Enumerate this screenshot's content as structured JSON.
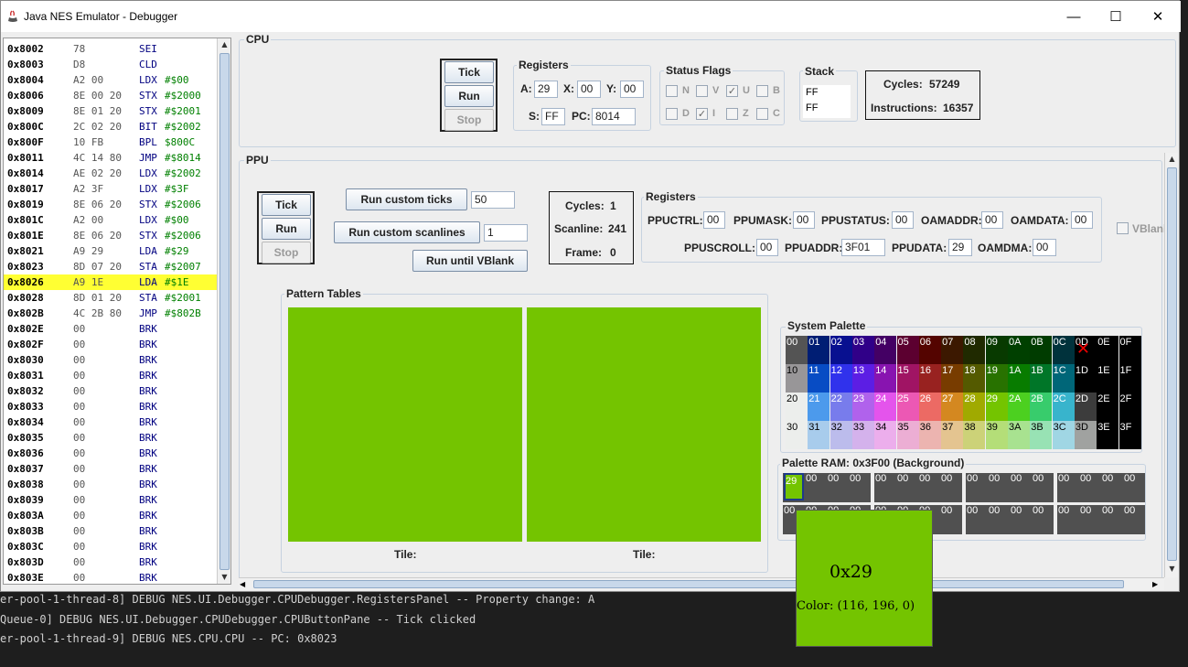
{
  "window": {
    "title": "Java NES Emulator - Debugger",
    "minimize": "—",
    "maximize": "☐",
    "close": "✕"
  },
  "code": {
    "rows": [
      {
        "addr": "0x8002",
        "bytes": "78",
        "mn": "SEI",
        "op": ""
      },
      {
        "addr": "0x8003",
        "bytes": "D8",
        "mn": "CLD",
        "op": ""
      },
      {
        "addr": "0x8004",
        "bytes": "A2 00",
        "mn": "LDX",
        "op": "#$00"
      },
      {
        "addr": "0x8006",
        "bytes": "8E 00 20",
        "mn": "STX",
        "op": "#$2000"
      },
      {
        "addr": "0x8009",
        "bytes": "8E 01 20",
        "mn": "STX",
        "op": "#$2001"
      },
      {
        "addr": "0x800C",
        "bytes": "2C 02 20",
        "mn": "BIT",
        "op": "#$2002"
      },
      {
        "addr": "0x800F",
        "bytes": "10 FB",
        "mn": "BPL",
        "op": "$800C"
      },
      {
        "addr": "0x8011",
        "bytes": "4C 14 80",
        "mn": "JMP",
        "op": "#$8014"
      },
      {
        "addr": "0x8014",
        "bytes": "AE 02 20",
        "mn": "LDX",
        "op": "#$2002"
      },
      {
        "addr": "0x8017",
        "bytes": "A2 3F",
        "mn": "LDX",
        "op": "#$3F"
      },
      {
        "addr": "0x8019",
        "bytes": "8E 06 20",
        "mn": "STX",
        "op": "#$2006"
      },
      {
        "addr": "0x801C",
        "bytes": "A2 00",
        "mn": "LDX",
        "op": "#$00"
      },
      {
        "addr": "0x801E",
        "bytes": "8E 06 20",
        "mn": "STX",
        "op": "#$2006"
      },
      {
        "addr": "0x8021",
        "bytes": "A9 29",
        "mn": "LDA",
        "op": "#$29"
      },
      {
        "addr": "0x8023",
        "bytes": "8D 07 20",
        "mn": "STA",
        "op": "#$2007"
      },
      {
        "addr": "0x8026",
        "bytes": "A9 1E",
        "mn": "LDA",
        "op": "#$1E",
        "hl": true
      },
      {
        "addr": "0x8028",
        "bytes": "8D 01 20",
        "mn": "STA",
        "op": "#$2001"
      },
      {
        "addr": "0x802B",
        "bytes": "4C 2B 80",
        "mn": "JMP",
        "op": "#$802B"
      },
      {
        "addr": "0x802E",
        "bytes": "00",
        "mn": "BRK",
        "op": ""
      },
      {
        "addr": "0x802F",
        "bytes": "00",
        "mn": "BRK",
        "op": ""
      },
      {
        "addr": "0x8030",
        "bytes": "00",
        "mn": "BRK",
        "op": ""
      },
      {
        "addr": "0x8031",
        "bytes": "00",
        "mn": "BRK",
        "op": ""
      },
      {
        "addr": "0x8032",
        "bytes": "00",
        "mn": "BRK",
        "op": ""
      },
      {
        "addr": "0x8033",
        "bytes": "00",
        "mn": "BRK",
        "op": ""
      },
      {
        "addr": "0x8034",
        "bytes": "00",
        "mn": "BRK",
        "op": ""
      },
      {
        "addr": "0x8035",
        "bytes": "00",
        "mn": "BRK",
        "op": ""
      },
      {
        "addr": "0x8036",
        "bytes": "00",
        "mn": "BRK",
        "op": ""
      },
      {
        "addr": "0x8037",
        "bytes": "00",
        "mn": "BRK",
        "op": ""
      },
      {
        "addr": "0x8038",
        "bytes": "00",
        "mn": "BRK",
        "op": ""
      },
      {
        "addr": "0x8039",
        "bytes": "00",
        "mn": "BRK",
        "op": ""
      },
      {
        "addr": "0x803A",
        "bytes": "00",
        "mn": "BRK",
        "op": ""
      },
      {
        "addr": "0x803B",
        "bytes": "00",
        "mn": "BRK",
        "op": ""
      },
      {
        "addr": "0x803C",
        "bytes": "00",
        "mn": "BRK",
        "op": ""
      },
      {
        "addr": "0x803D",
        "bytes": "00",
        "mn": "BRK",
        "op": ""
      },
      {
        "addr": "0x803E",
        "bytes": "00",
        "mn": "BRK",
        "op": ""
      }
    ]
  },
  "cpu": {
    "title": "CPU",
    "tick": "Tick",
    "run": "Run",
    "stop": "Stop",
    "registers_title": "Registers",
    "a_label": "A:",
    "a": "29",
    "x_label": "X:",
    "x": "00",
    "y_label": "Y:",
    "y": "00",
    "s_label": "S:",
    "s": "FF",
    "pc_label": "PC:",
    "pc": "8014",
    "flags_title": "Status Flags",
    "flags": [
      {
        "name": "N",
        "checked": false
      },
      {
        "name": "V",
        "checked": false
      },
      {
        "name": "U",
        "checked": true
      },
      {
        "name": "B",
        "checked": false
      },
      {
        "name": "D",
        "checked": false
      },
      {
        "name": "I",
        "checked": true
      },
      {
        "name": "Z",
        "checked": false
      },
      {
        "name": "C",
        "checked": false
      }
    ],
    "stack_title": "Stack",
    "stack": [
      "FF",
      "FF"
    ],
    "cycles_label": "Cycles:",
    "cycles": "57249",
    "instructions_label": "Instructions:",
    "instructions": "16357"
  },
  "ppu": {
    "title": "PPU",
    "tick": "Tick",
    "run": "Run",
    "stop": "Stop",
    "run_ticks": "Run custom ticks",
    "ticks_value": "50",
    "run_scanlines": "Run custom scanlines",
    "scanlines_value": "1",
    "run_vblank": "Run until VBlank",
    "cycles_label": "Cycles:",
    "cycles": "1",
    "scanline_label": "Scanline:",
    "scanline": "241",
    "frame_label": "Frame:",
    "frame": "0",
    "registers_title": "Registers",
    "regs_row1": [
      {
        "label": "PPUCTRL:",
        "value": "00"
      },
      {
        "label": "PPUMASK:",
        "value": "00"
      },
      {
        "label": "PPUSTATUS:",
        "value": "00"
      },
      {
        "label": "OAMADDR:",
        "value": "00"
      },
      {
        "label": "OAMDATA:",
        "value": "00"
      }
    ],
    "regs_row2": [
      {
        "label": "PPUSCROLL:",
        "value": "00"
      },
      {
        "label": "PPUADDR:",
        "value": "3F01"
      },
      {
        "label": "PPUDATA:",
        "value": "29"
      },
      {
        "label": "OAMDMA:",
        "value": "00"
      }
    ],
    "vblank_label": "VBlank",
    "pattern_title": "Pattern Tables",
    "tile_label": "Tile:",
    "pattern_color": "#74c400",
    "system_palette_title": "System Palette",
    "palette": [
      [
        "00",
        "01",
        "02",
        "03",
        "04",
        "05",
        "06",
        "07",
        "08",
        "09",
        "0A",
        "0B",
        "0C",
        "0D",
        "0E",
        "0F"
      ],
      [
        "10",
        "11",
        "12",
        "13",
        "14",
        "15",
        "16",
        "17",
        "18",
        "19",
        "1A",
        "1B",
        "1C",
        "1D",
        "1E",
        "1F"
      ],
      [
        "20",
        "21",
        "22",
        "23",
        "24",
        "25",
        "26",
        "27",
        "28",
        "29",
        "2A",
        "2B",
        "2C",
        "2D",
        "2E",
        "2F"
      ],
      [
        "30",
        "31",
        "32",
        "33",
        "34",
        "35",
        "36",
        "37",
        "38",
        "39",
        "3A",
        "3B",
        "3C",
        "3D",
        "3E",
        "3F"
      ]
    ],
    "palette_colors": [
      [
        "#545454",
        "#001e74",
        "#081090",
        "#300088",
        "#440064",
        "#5c0030",
        "#540400",
        "#3c1800",
        "#202a00",
        "#083a00",
        "#004000",
        "#003c00",
        "#00323c",
        "#000000",
        "#000000",
        "#000000"
      ],
      [
        "#989698",
        "#084cc4",
        "#3032ec",
        "#5c1ee4",
        "#8814b0",
        "#a01464",
        "#982220",
        "#783c00",
        "#545a00",
        "#287200",
        "#087c00",
        "#007628",
        "#006678",
        "#000000",
        "#000000",
        "#000000"
      ],
      [
        "#eceeec",
        "#4c9aec",
        "#787cec",
        "#b062ec",
        "#e454ec",
        "#ec58b4",
        "#ec6a64",
        "#d48820",
        "#a0aa00",
        "#74c400",
        "#4cd020",
        "#38cc6c",
        "#38b4cc",
        "#3c3c3c",
        "#000000",
        "#000000"
      ],
      [
        "#eceeec",
        "#a8ccec",
        "#bcbcec",
        "#d4b2ec",
        "#ecaeec",
        "#ecaed4",
        "#ecb4b0",
        "#e4c490",
        "#ccd278",
        "#b4de78",
        "#a8e290",
        "#98e2b4",
        "#a0d6e4",
        "#a0a2a0",
        "#000000",
        "#000000"
      ]
    ],
    "palette_ram_title": "Palette RAM: 0x3F00 (Background)",
    "palette_ram": [
      [
        "29",
        "00",
        "00",
        "00"
      ],
      [
        "00",
        "00",
        "00",
        "00"
      ],
      [
        "00",
        "00",
        "00",
        "00"
      ],
      [
        "00",
        "00",
        "00",
        "00"
      ],
      [
        "00",
        "00",
        "00",
        "00"
      ],
      [
        "00",
        "00",
        "00",
        "00"
      ],
      [
        "00",
        "00",
        "00",
        "00"
      ],
      [
        "00",
        "00",
        "00",
        "00"
      ]
    ]
  },
  "tooltip": {
    "hex": "0x29",
    "color_text": "Color: (116, 196, 0)",
    "color": "#74c400"
  },
  "log": [
    "er-pool-1-thread-8] DEBUG NES.UI.Debugger.CPUDebugger.RegistersPanel -- Property change: A",
    "Queue-0] DEBUG NES.UI.Debugger.CPUDebugger.CPUButtonPane -- Tick clicked",
    "er-pool-1-thread-9] DEBUG NES.CPU.CPU -- PC: 0x8023"
  ]
}
